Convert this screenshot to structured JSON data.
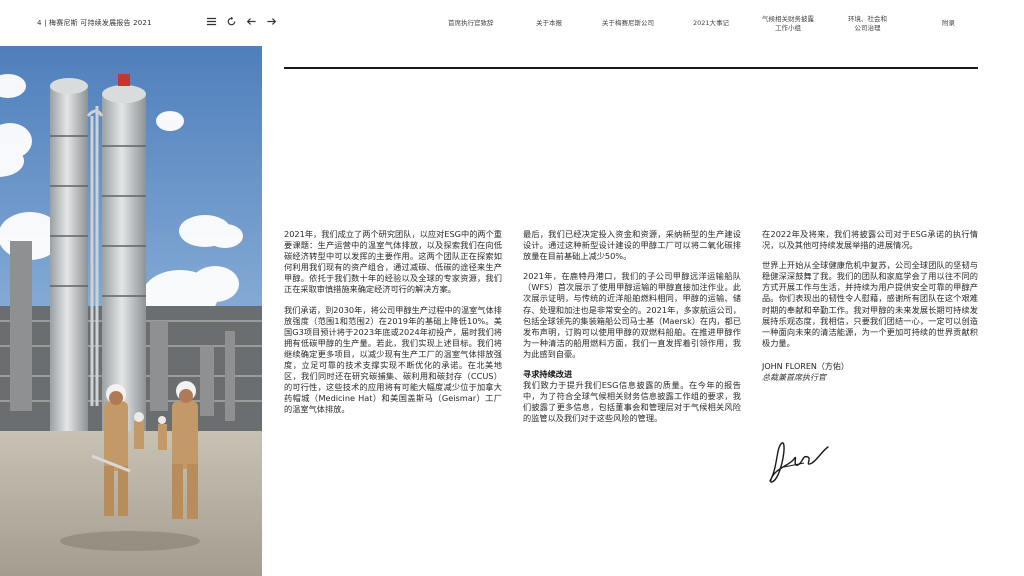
{
  "header": {
    "doc_title": "4 | 梅赛尼斯 可持续发展报告 2021",
    "tools": {
      "menu_icon": "menu-icon",
      "refresh_icon": "refresh-icon",
      "back_icon": "arrow-left-icon",
      "forward_icon": "arrow-right-icon"
    },
    "nav": [
      {
        "label": "首席执行官致辞"
      },
      {
        "label": "关于本报"
      },
      {
        "label": "关于梅赛尼斯公司"
      },
      {
        "label": "2021大事记"
      },
      {
        "label": "气候相关财务披露\n工作小组"
      },
      {
        "label": "环境、社会和\n公司治理"
      },
      {
        "label": "附录"
      }
    ]
  },
  "article": {
    "col1": [
      "2021年，我们成立了两个研究团队，以应对ESG中的两个重要课题：生产运营中的温室气体排放，以及探索我们在向低碳经济转型中可以发挥的主要作用。这两个团队正在探索如何利用我们现有的资产组合，通过减碳、低碳的途径来生产甲醇。依托于我们数十年的经验以及全球的专家资源，我们正在采取审慎措施来确定经济可行的解决方案。",
      "我们承诺，到2030年，将公司甲醇生产过程中的温室气体排放强度（范围1和范围2）在2019年的基础上降低10%。美国G3项目预计将于2023年底或2024年初投产，届时我们将拥有低碳甲醇的生产量。若此，我们实现上述目标。我们将继续确定更多项目，以减少现有生产工厂的温室气体排放强度，立足可靠的技术支撑实现不断优化的承诺。在北美地区，我们同时还在研究碳捕集、碳利用和碳封存（CCUS）的可行性，这些技术的应用将有可能大幅度减少位于加拿大药帽城（Medicine Hat）和美国盖斯马（Geismar）工厂的温室气体排放。"
    ],
    "col2": [
      "最后，我们已经决定投入资金和资源，采纳新型的生产建设设计。通过这种新型设计建设的甲醇工厂可以将二氧化碳排放量在目前基础上减少50%。",
      "2021年，在鹿特丹港口，我们的子公司甲醇远洋运输船队（WFS）首次展示了使用甲醇运输的甲醇直接加注作业。此次展示证明，与传统的近洋船舶燃料相同，甲醇的运输、储存、处理和加注也是非常安全的。2021年，多家航运公司，包括全球领先的集装箱船公司马士基（Maersk）在内，都已发布声明，订购可以使用甲醇的双燃料船舶。在推进甲醇作为一种清洁的船用燃料方面，我们一直发挥着引领作用，我为此感到自豪。"
    ],
    "col2_heading": "寻求持续改进",
    "col2_after": "我们致力于提升我们ESG信息披露的质量。在今年的报告中，为了符合全球气候相关财务信息披露工作组的要求，我们披露了更多信息，包括董事会和管理层对于气候相关风险的监管以及我们对于这些风险的管理。",
    "col3": [
      "在2022年及将来，我们将披露公司对于ESG承诺的执行情况，以及其他可持续发展举措的进展情况。",
      "世界上开始从全球健康危机中复苏，公司全球团队的坚韧与稳健深深鼓舞了我。我们的团队和家庭学会了用以往不同的方式开展工作与生活，并持续为用户提供安全可靠的甲醇产品。你们表现出的韧性令人慰藉，感谢所有团队在这个艰难时期的奉献和辛勤工作。我对甲醇的未来发展长期可持续发展持乐观态度，我相信，只要我们团结一心，一定可以创造一种面向未来的清洁能源，为一个更加可持续的世界贡献积极力量。"
    ],
    "signature_name": "JOHN FLOREN（方佑）",
    "signature_title": "总裁兼首席执行官"
  },
  "colors": {
    "sky": "#6e98c8",
    "rule": "#1a1a1a",
    "coverall": "#c39a67",
    "hardhat": "#f2f2f2"
  }
}
